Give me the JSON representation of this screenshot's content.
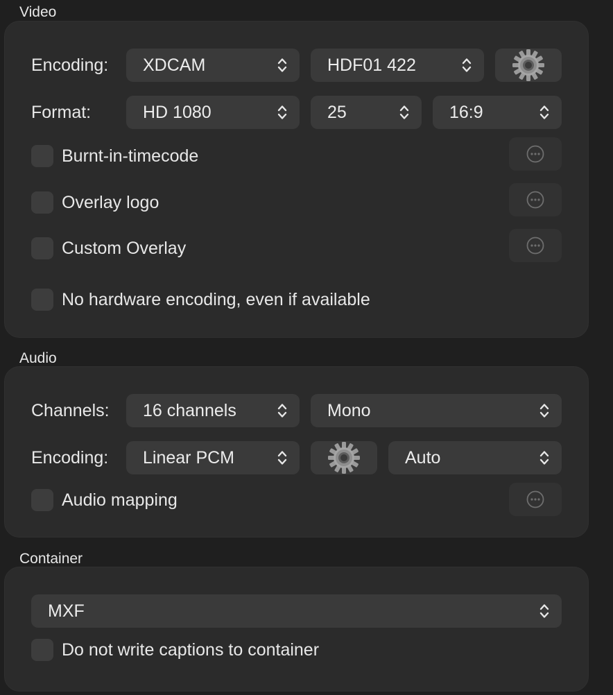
{
  "video": {
    "title": "Video",
    "encoding_label": "Encoding:",
    "encoding_value": "XDCAM",
    "profile_value": "HDF01 422",
    "format_label": "Format:",
    "format_value": "HD 1080",
    "framerate_value": "25",
    "aspect_value": "16:9",
    "burnt_in_timecode": "Burnt-in-timecode",
    "overlay_logo": "Overlay logo",
    "custom_overlay": "Custom Overlay",
    "no_hardware_encoding": "No hardware encoding, even if available"
  },
  "audio": {
    "title": "Audio",
    "channels_label": "Channels:",
    "channels_value": "16 channels",
    "layout_value": "Mono",
    "encoding_label": "Encoding:",
    "encoding_value": "Linear PCM",
    "rate_value": "Auto",
    "audio_mapping": "Audio mapping"
  },
  "container": {
    "title": "Container",
    "format_value": "MXF",
    "no_captions": "Do not write captions to container"
  },
  "icons": {
    "gear": "gear-icon",
    "more": "ellipsis-circle-icon",
    "chevron": "chevron-up-down-icon"
  },
  "colors": {
    "background": "#1f1f1f",
    "panel": "#2b2b2b",
    "control": "#3a3a3a",
    "text": "#e8e8e8"
  }
}
